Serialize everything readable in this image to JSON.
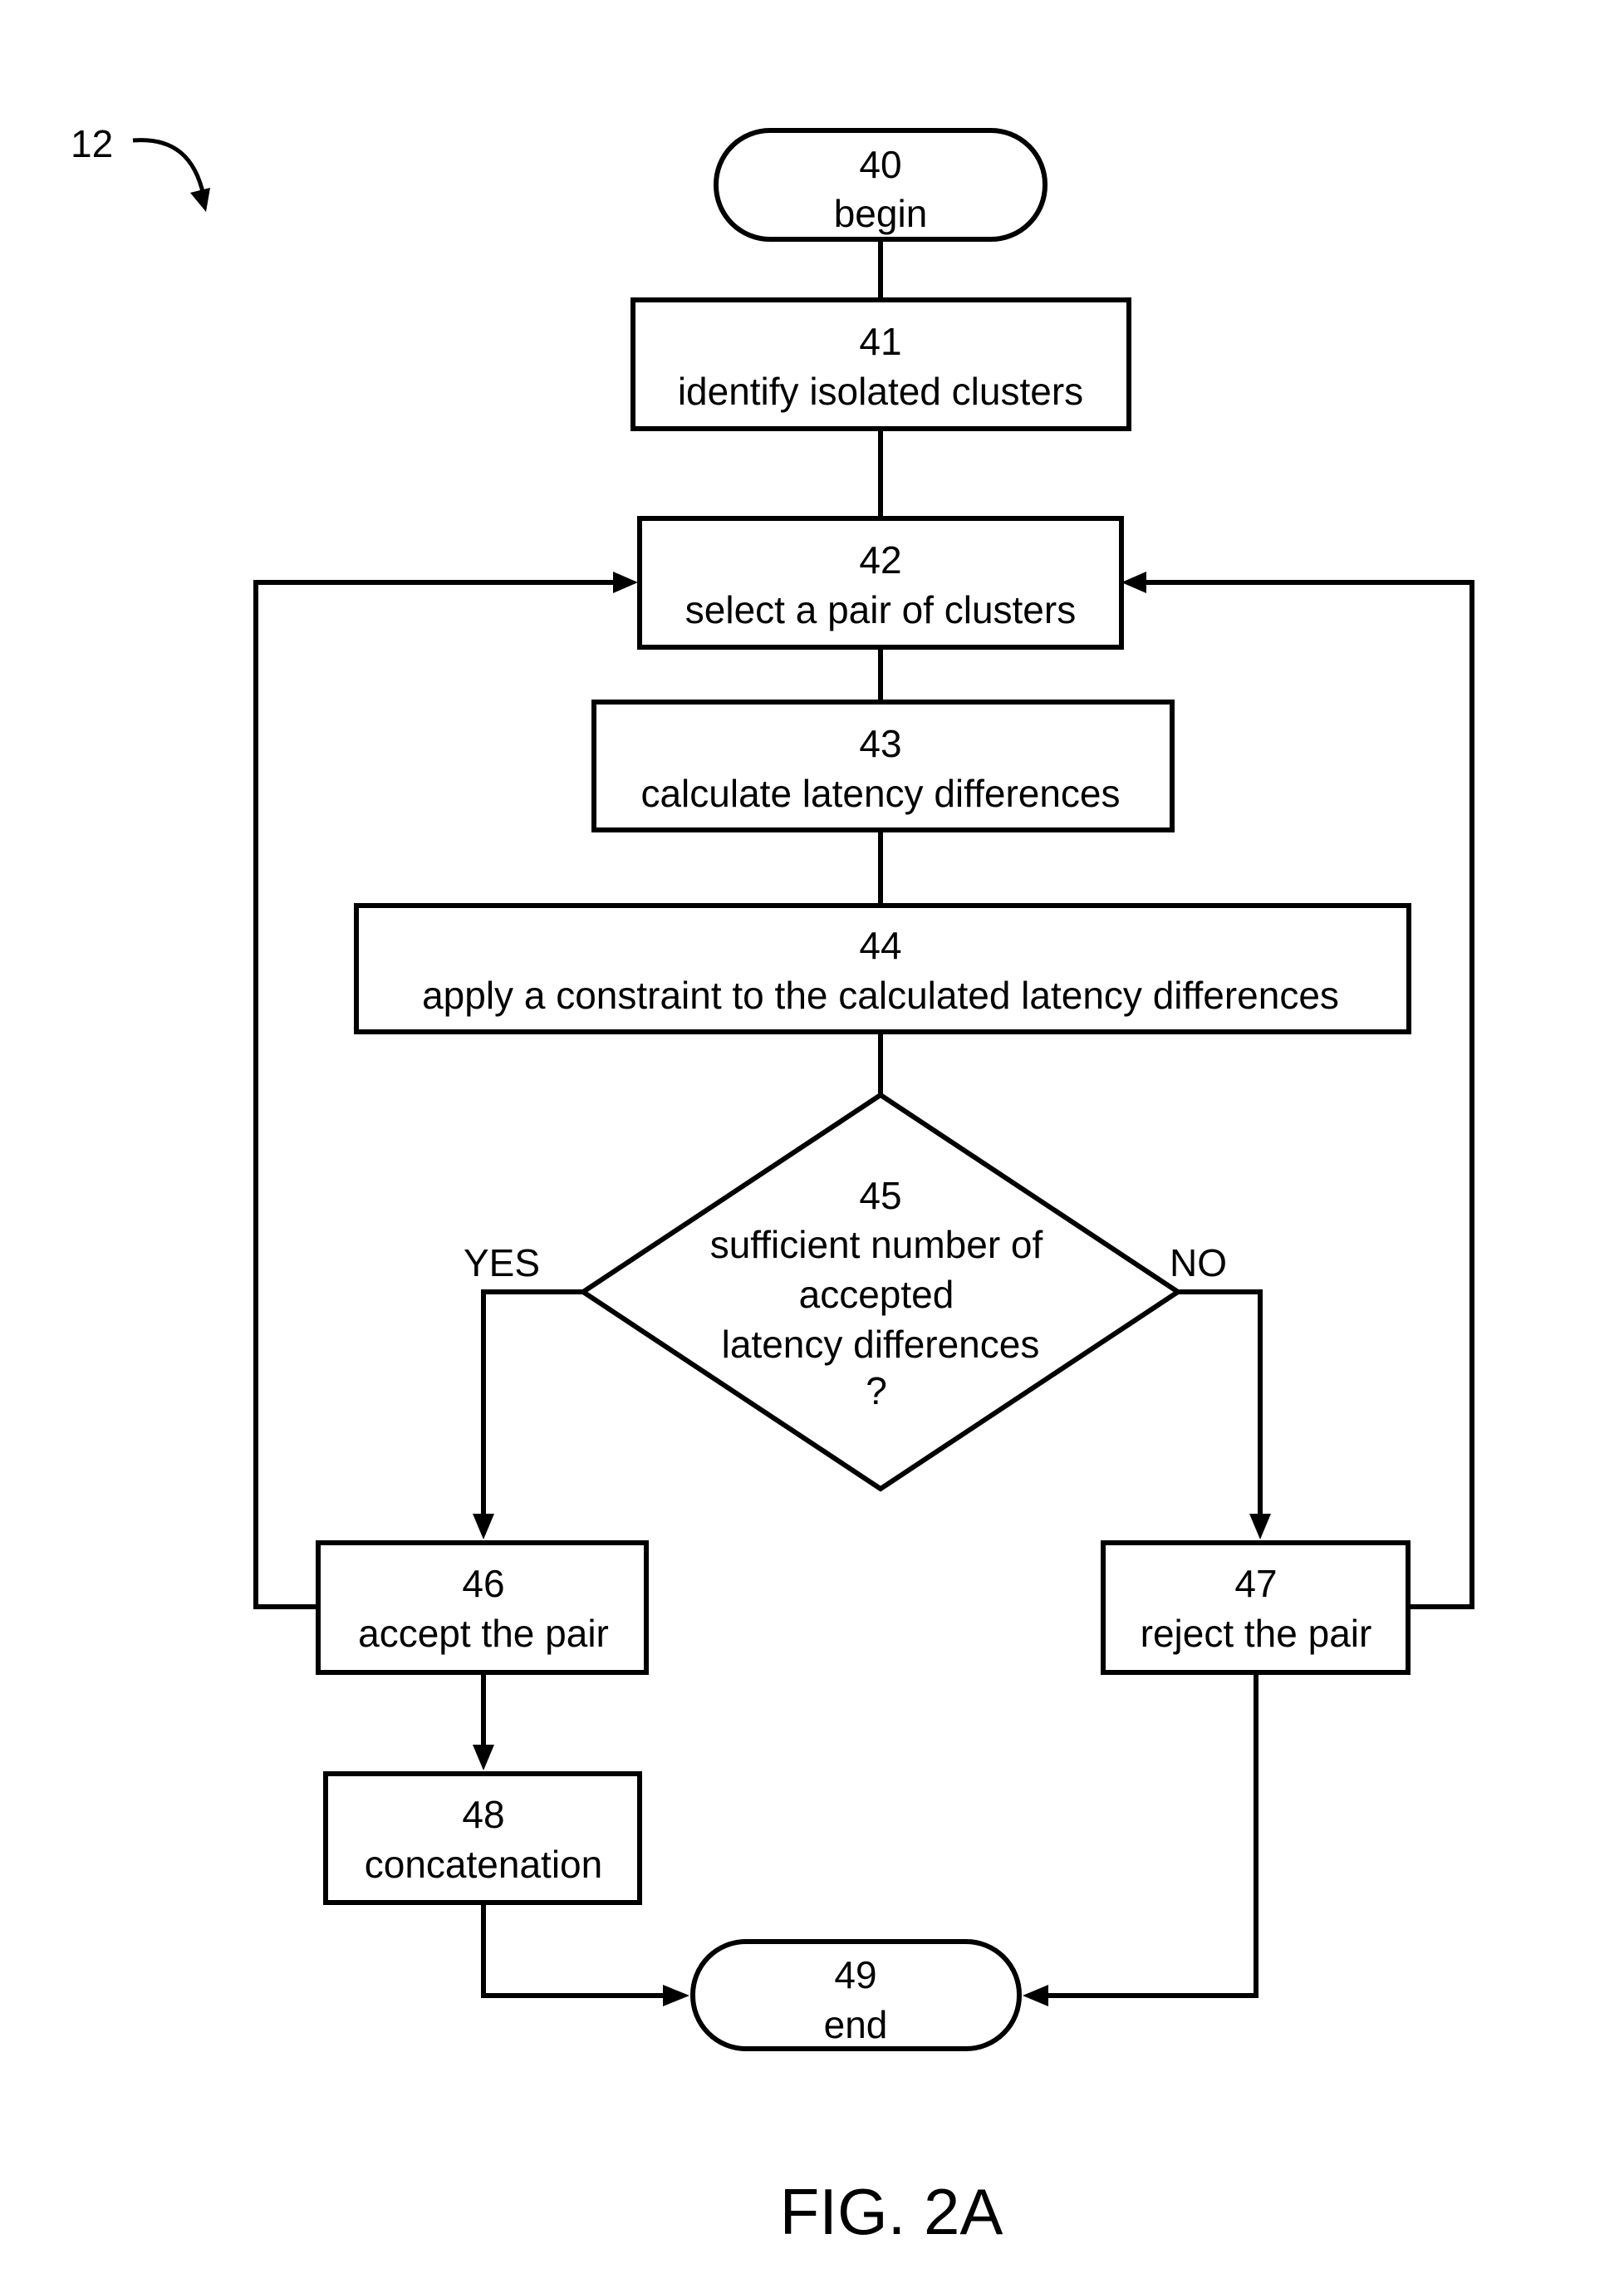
{
  "figure": {
    "reference_numeral": "12",
    "caption": "FIG. 2A"
  },
  "nodes": {
    "begin": {
      "id": "40",
      "shape": "terminal",
      "lines": [
        "40",
        "begin"
      ]
    },
    "identify": {
      "id": "41",
      "shape": "process",
      "lines": [
        "41",
        "identify isolated clusters"
      ]
    },
    "select": {
      "id": "42",
      "shape": "process",
      "lines": [
        "42",
        "select a pair of clusters"
      ]
    },
    "calculate": {
      "id": "43",
      "shape": "process",
      "lines": [
        "43",
        "calculate latency differences"
      ]
    },
    "constraint": {
      "id": "44",
      "shape": "process",
      "lines": [
        "44",
        "apply a constraint to the calculated latency differences"
      ]
    },
    "decision": {
      "id": "45",
      "shape": "decision",
      "lines": [
        "45",
        "sufficient number of",
        "accepted",
        "latency differences",
        "?"
      ]
    },
    "accept": {
      "id": "46",
      "shape": "process",
      "lines": [
        "46",
        "accept the pair"
      ]
    },
    "reject": {
      "id": "47",
      "shape": "process",
      "lines": [
        "47",
        "reject the pair"
      ]
    },
    "concat": {
      "id": "48",
      "shape": "process",
      "lines": [
        "48",
        "concatenation"
      ]
    },
    "end": {
      "id": "49",
      "shape": "terminal",
      "lines": [
        "49",
        "end"
      ]
    }
  },
  "branches": {
    "yes": "YES",
    "no": "NO"
  },
  "edges": [
    {
      "from": "40",
      "to": "41"
    },
    {
      "from": "41",
      "to": "42"
    },
    {
      "from": "42",
      "to": "43"
    },
    {
      "from": "43",
      "to": "44"
    },
    {
      "from": "44",
      "to": "45"
    },
    {
      "from": "45",
      "to": "46",
      "label": "YES"
    },
    {
      "from": "45",
      "to": "47",
      "label": "NO"
    },
    {
      "from": "46",
      "to": "42"
    },
    {
      "from": "47",
      "to": "42"
    },
    {
      "from": "46",
      "to": "48"
    },
    {
      "from": "48",
      "to": "49"
    },
    {
      "from": "47",
      "to": "49"
    }
  ]
}
